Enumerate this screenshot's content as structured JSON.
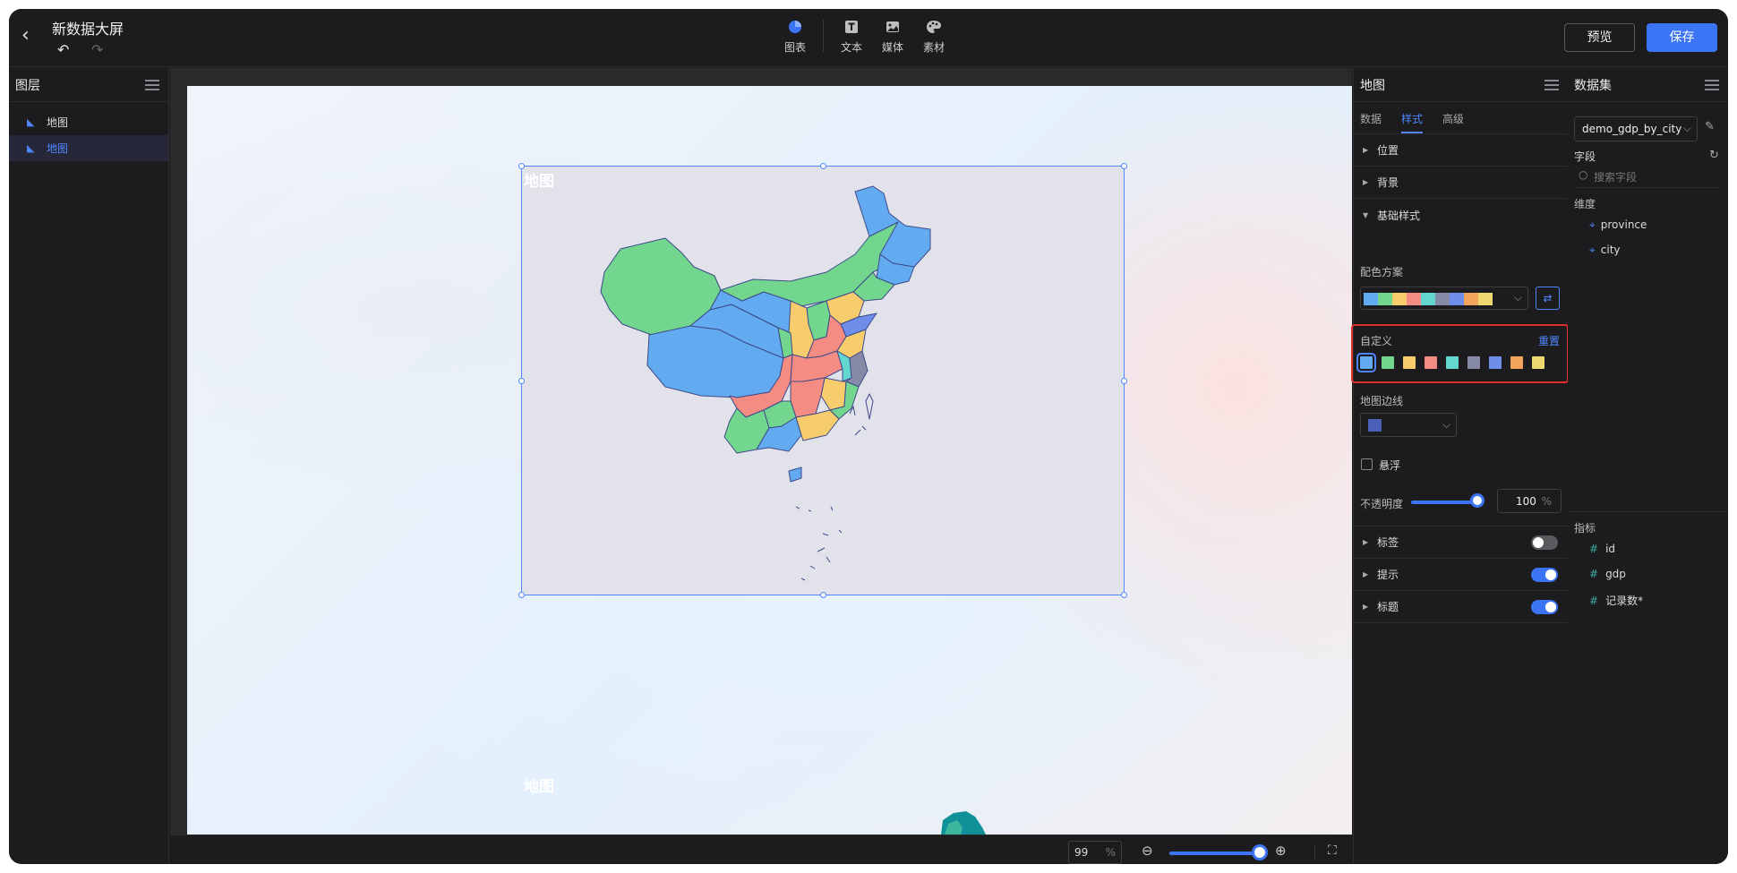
{
  "header": {
    "title": "新数据大屏",
    "tools": [
      {
        "label": "图表",
        "icon": "pie-chart-icon"
      },
      {
        "label": "文本",
        "icon": "text-icon"
      },
      {
        "label": "媒体",
        "icon": "image-icon"
      },
      {
        "label": "素材",
        "icon": "palette-icon"
      }
    ],
    "preview_label": "预览",
    "save_label": "保存"
  },
  "layers": {
    "title": "图层",
    "items": [
      {
        "label": "地图",
        "selected": false
      },
      {
        "label": "地图",
        "selected": true
      }
    ]
  },
  "canvas": {
    "map_title": "地图",
    "ghost_title": "地图"
  },
  "zoom": {
    "value": "99",
    "unit": "%",
    "slider_fraction": 0.92
  },
  "style_panel": {
    "title": "地图",
    "tabs": [
      {
        "label": "数据",
        "active": false
      },
      {
        "label": "样式",
        "active": true
      },
      {
        "label": "高级",
        "active": false
      }
    ],
    "sections_top": [
      "位置",
      "背景"
    ],
    "basic_style": "基础样式",
    "color_scheme_label": "配色方案",
    "scheme_colors": [
      "#63abf0",
      "#72d68e",
      "#f6cc6c",
      "#f58c84",
      "#63d6cf",
      "#868aa7",
      "#6f8eea",
      "#f2a55a",
      "#f0d870"
    ],
    "custom_label": "自定义",
    "reset_label": "重置",
    "custom_colors": [
      "#63abf0",
      "#72d68e",
      "#f6cc6c",
      "#f58c84",
      "#63d6cf",
      "#868aa7",
      "#6f8eea",
      "#f2a55a",
      "#f0d870"
    ],
    "border_label": "地图边线",
    "border_color": "#4a60b6",
    "hover_label": "悬浮",
    "hover_checked": false,
    "opacity_label": "不透明度",
    "opacity_value": "100",
    "opacity_unit": "%",
    "toggles": [
      {
        "label": "标签",
        "on": false
      },
      {
        "label": "提示",
        "on": true
      },
      {
        "label": "标题",
        "on": true
      }
    ]
  },
  "data_panel": {
    "title": "数据集",
    "dataset": "demo_gdp_by_city",
    "fields_label": "字段",
    "search_placeholder": "搜索字段",
    "dimension_label": "维度",
    "dimensions": [
      "province",
      "city"
    ],
    "metric_label": "指标",
    "metrics": [
      "id",
      "gdp",
      "记录数*"
    ]
  }
}
